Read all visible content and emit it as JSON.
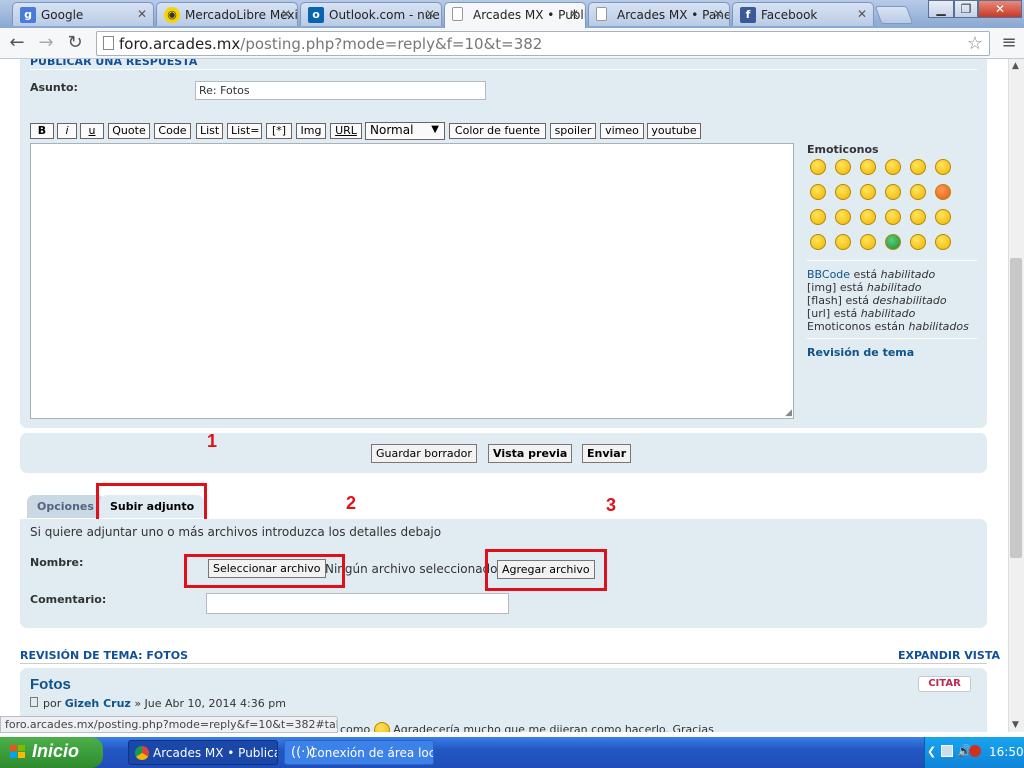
{
  "browser": {
    "tabs": [
      {
        "label": "Google",
        "icon": "google-icon",
        "color": "#4a7bd8"
      },
      {
        "label": "MercadoLibre Mexi",
        "icon": "mercadolibre-icon",
        "color": "#f5d400"
      },
      {
        "label": "Outlook.com - nue",
        "icon": "outlook-icon",
        "color": "#0a64ad"
      },
      {
        "label": "Arcades MX • Publi",
        "icon": "page-icon",
        "color": "#ffffff"
      },
      {
        "label": "Arcades MX • Pane",
        "icon": "page-icon",
        "color": "#ffffff"
      },
      {
        "label": "Facebook",
        "icon": "facebook-icon",
        "color": "#3b5998"
      }
    ],
    "url_host": "foro.arcades.mx",
    "url_path": "/posting.php?mode=reply&f=10&t=382",
    "status_url": "foro.arcades.mx/posting.php?mode=reply&f=10&t=382#tabs"
  },
  "form": {
    "section_title": "PUBLICAR UNA RESPUESTA",
    "subject_label": "Asunto:",
    "subject_value": "Re: Fotos",
    "bbcode_buttons": [
      "B",
      "i",
      "u",
      "Quote",
      "Code",
      "List",
      "List=",
      "[*]",
      "Img",
      "URL"
    ],
    "font_size_select": "Normal",
    "extra_buttons": [
      "Color de fuente",
      "spoiler",
      "vimeo",
      "youtube"
    ],
    "save_draft": "Guardar borrador",
    "preview": "Vista previa",
    "submit": "Enviar"
  },
  "sidebar": {
    "emoticons_title": "Emoticonos",
    "bbcode_link": "BBCode",
    "bbcode_text": " está ",
    "bbcode_state": "habilitado",
    "img_text": "[img] está ",
    "img_state": "habilitado",
    "flash_text": "[flash] está ",
    "flash_state": "deshabilitado",
    "url_text": "[url] está ",
    "url_state": "habilitado",
    "emot_text": "Emoticonos están ",
    "emot_state": "habilitados",
    "review_link": "Revisión de tema"
  },
  "attachment": {
    "tab_options": "Opciones",
    "tab_upload": "Subir adjunto",
    "intro": "Si quiere adjuntar uno o más archivos introduzca los detalles debajo",
    "name_label": "Nombre:",
    "select_file": "Seleccionar archivo",
    "no_file": "Ningún archivo seleccionado",
    "add_file": "Agregar archivo",
    "comment_label": "Comentario:"
  },
  "annotations": [
    "1",
    "2",
    "3"
  ],
  "review": {
    "header": "REVISIÓN DE TEMA: FOTOS",
    "expand": "EXPANDIR VISTA",
    "post_title": "Fotos",
    "quote_btn": "CITAR",
    "by": "por",
    "author": "Gizeh Cruz",
    "date": "» Jue Abr 10, 2014 4:36 pm",
    "body_pre": "como",
    "body_post": "Agradecería mucho que me dijeran como hacerlo. Gracias"
  },
  "taskbar": {
    "start": "Inicio",
    "tasks": [
      "Arcades MX • Publicar...",
      "Conexión de área loc..."
    ],
    "clock": "16:50"
  }
}
